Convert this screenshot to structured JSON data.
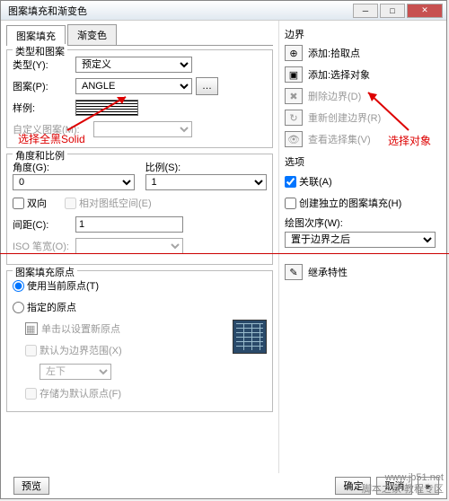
{
  "title": "图案填充和渐变色",
  "tabs": {
    "hatch": "图案填充",
    "gradient": "渐变色"
  },
  "typeGroup": {
    "title": "类型和图案",
    "typeLbl": "类型(Y):",
    "typeVal": "预定义",
    "patternLbl": "图案(P):",
    "patternVal": "ANGLE",
    "swatchLbl": "样例:",
    "customLbl": "自定义图案(M):"
  },
  "angleGroup": {
    "title": "角度和比例",
    "angleLbl": "角度(G):",
    "angleVal": "0",
    "scaleLbl": "比例(S):",
    "scaleVal": "1",
    "dual": "双向",
    "paper": "相对图纸空间(E)",
    "spacing": "间距(C):",
    "spacingVal": "1",
    "iso": "ISO 笔宽(O):"
  },
  "originGroup": {
    "title": "图案填充原点",
    "useCurrent": "使用当前原点(T)",
    "useSpec": "指定的原点",
    "click": "单击以设置新原点",
    "defaultExtent": "默认为边界范围(X)",
    "defaultExtentVal": "左下",
    "store": "存储为默认原点(F)"
  },
  "boundary": {
    "title": "边界",
    "addPick": "添加:拾取点",
    "addSelect": "添加:选择对象",
    "remove": "删除边界(D)",
    "recreate": "重新创建边界(R)",
    "viewSel": "查看选择集(V)"
  },
  "options": {
    "title": "选项",
    "assoc": "关联(A)",
    "indep": "创建独立的图案填充(H)",
    "drawOrder": "绘图次序(W):",
    "drawOrderVal": "置于边界之后",
    "inherit": "继承特性"
  },
  "buttons": {
    "preview": "预览",
    "ok": "确定",
    "cancel": "取消"
  },
  "annot": {
    "solid": "选择全黑Solid",
    "selObj": "选择对象"
  },
  "wm": {
    "l1": "www.jb51.net",
    "l2": "脚本之家 教程专区"
  }
}
